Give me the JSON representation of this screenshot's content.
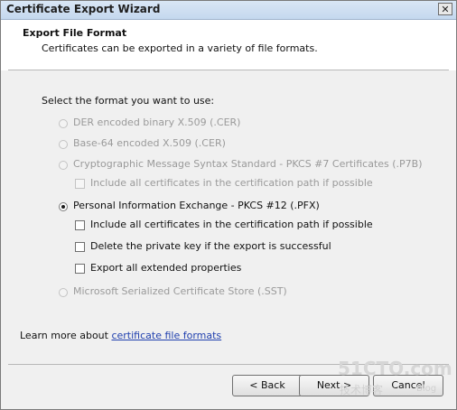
{
  "window": {
    "title": "Certificate Export Wizard",
    "close_glyph": "✕"
  },
  "header": {
    "title": "Export File Format",
    "subtitle": "Certificates can be exported in a variety of file formats."
  },
  "prompt": "Select the format you want to use:",
  "options": {
    "der": {
      "label": "DER encoded binary X.509 (.CER)",
      "enabled": false,
      "selected": false
    },
    "base64": {
      "label": "Base-64 encoded X.509 (.CER)",
      "enabled": false,
      "selected": false
    },
    "pkcs7": {
      "label": "Cryptographic Message Syntax Standard - PKCS #7 Certificates (.P7B)",
      "enabled": false,
      "selected": false,
      "include_path": {
        "label": "Include all certificates in the certification path if possible",
        "checked": false,
        "enabled": false
      }
    },
    "pfx": {
      "label": "Personal Information Exchange - PKCS #12 (.PFX)",
      "enabled": true,
      "selected": true,
      "include_path": {
        "label": "Include all certificates in the certification path if possible",
        "checked": false
      },
      "delete_key": {
        "label": "Delete the private key if the export is successful",
        "checked": false
      },
      "export_extended": {
        "label": "Export all extended properties",
        "checked": false
      }
    },
    "sst": {
      "label": "Microsoft Serialized Certificate Store (.SST)",
      "enabled": false,
      "selected": false
    }
  },
  "learn_more": {
    "prefix": "Learn more about ",
    "link": "certificate file formats"
  },
  "buttons": {
    "back": "< Back",
    "next": "Next >",
    "cancel": "Cancel"
  },
  "watermark": {
    "brand": "51CTO.com",
    "cn": "技术博客",
    "blog": "Blog"
  }
}
